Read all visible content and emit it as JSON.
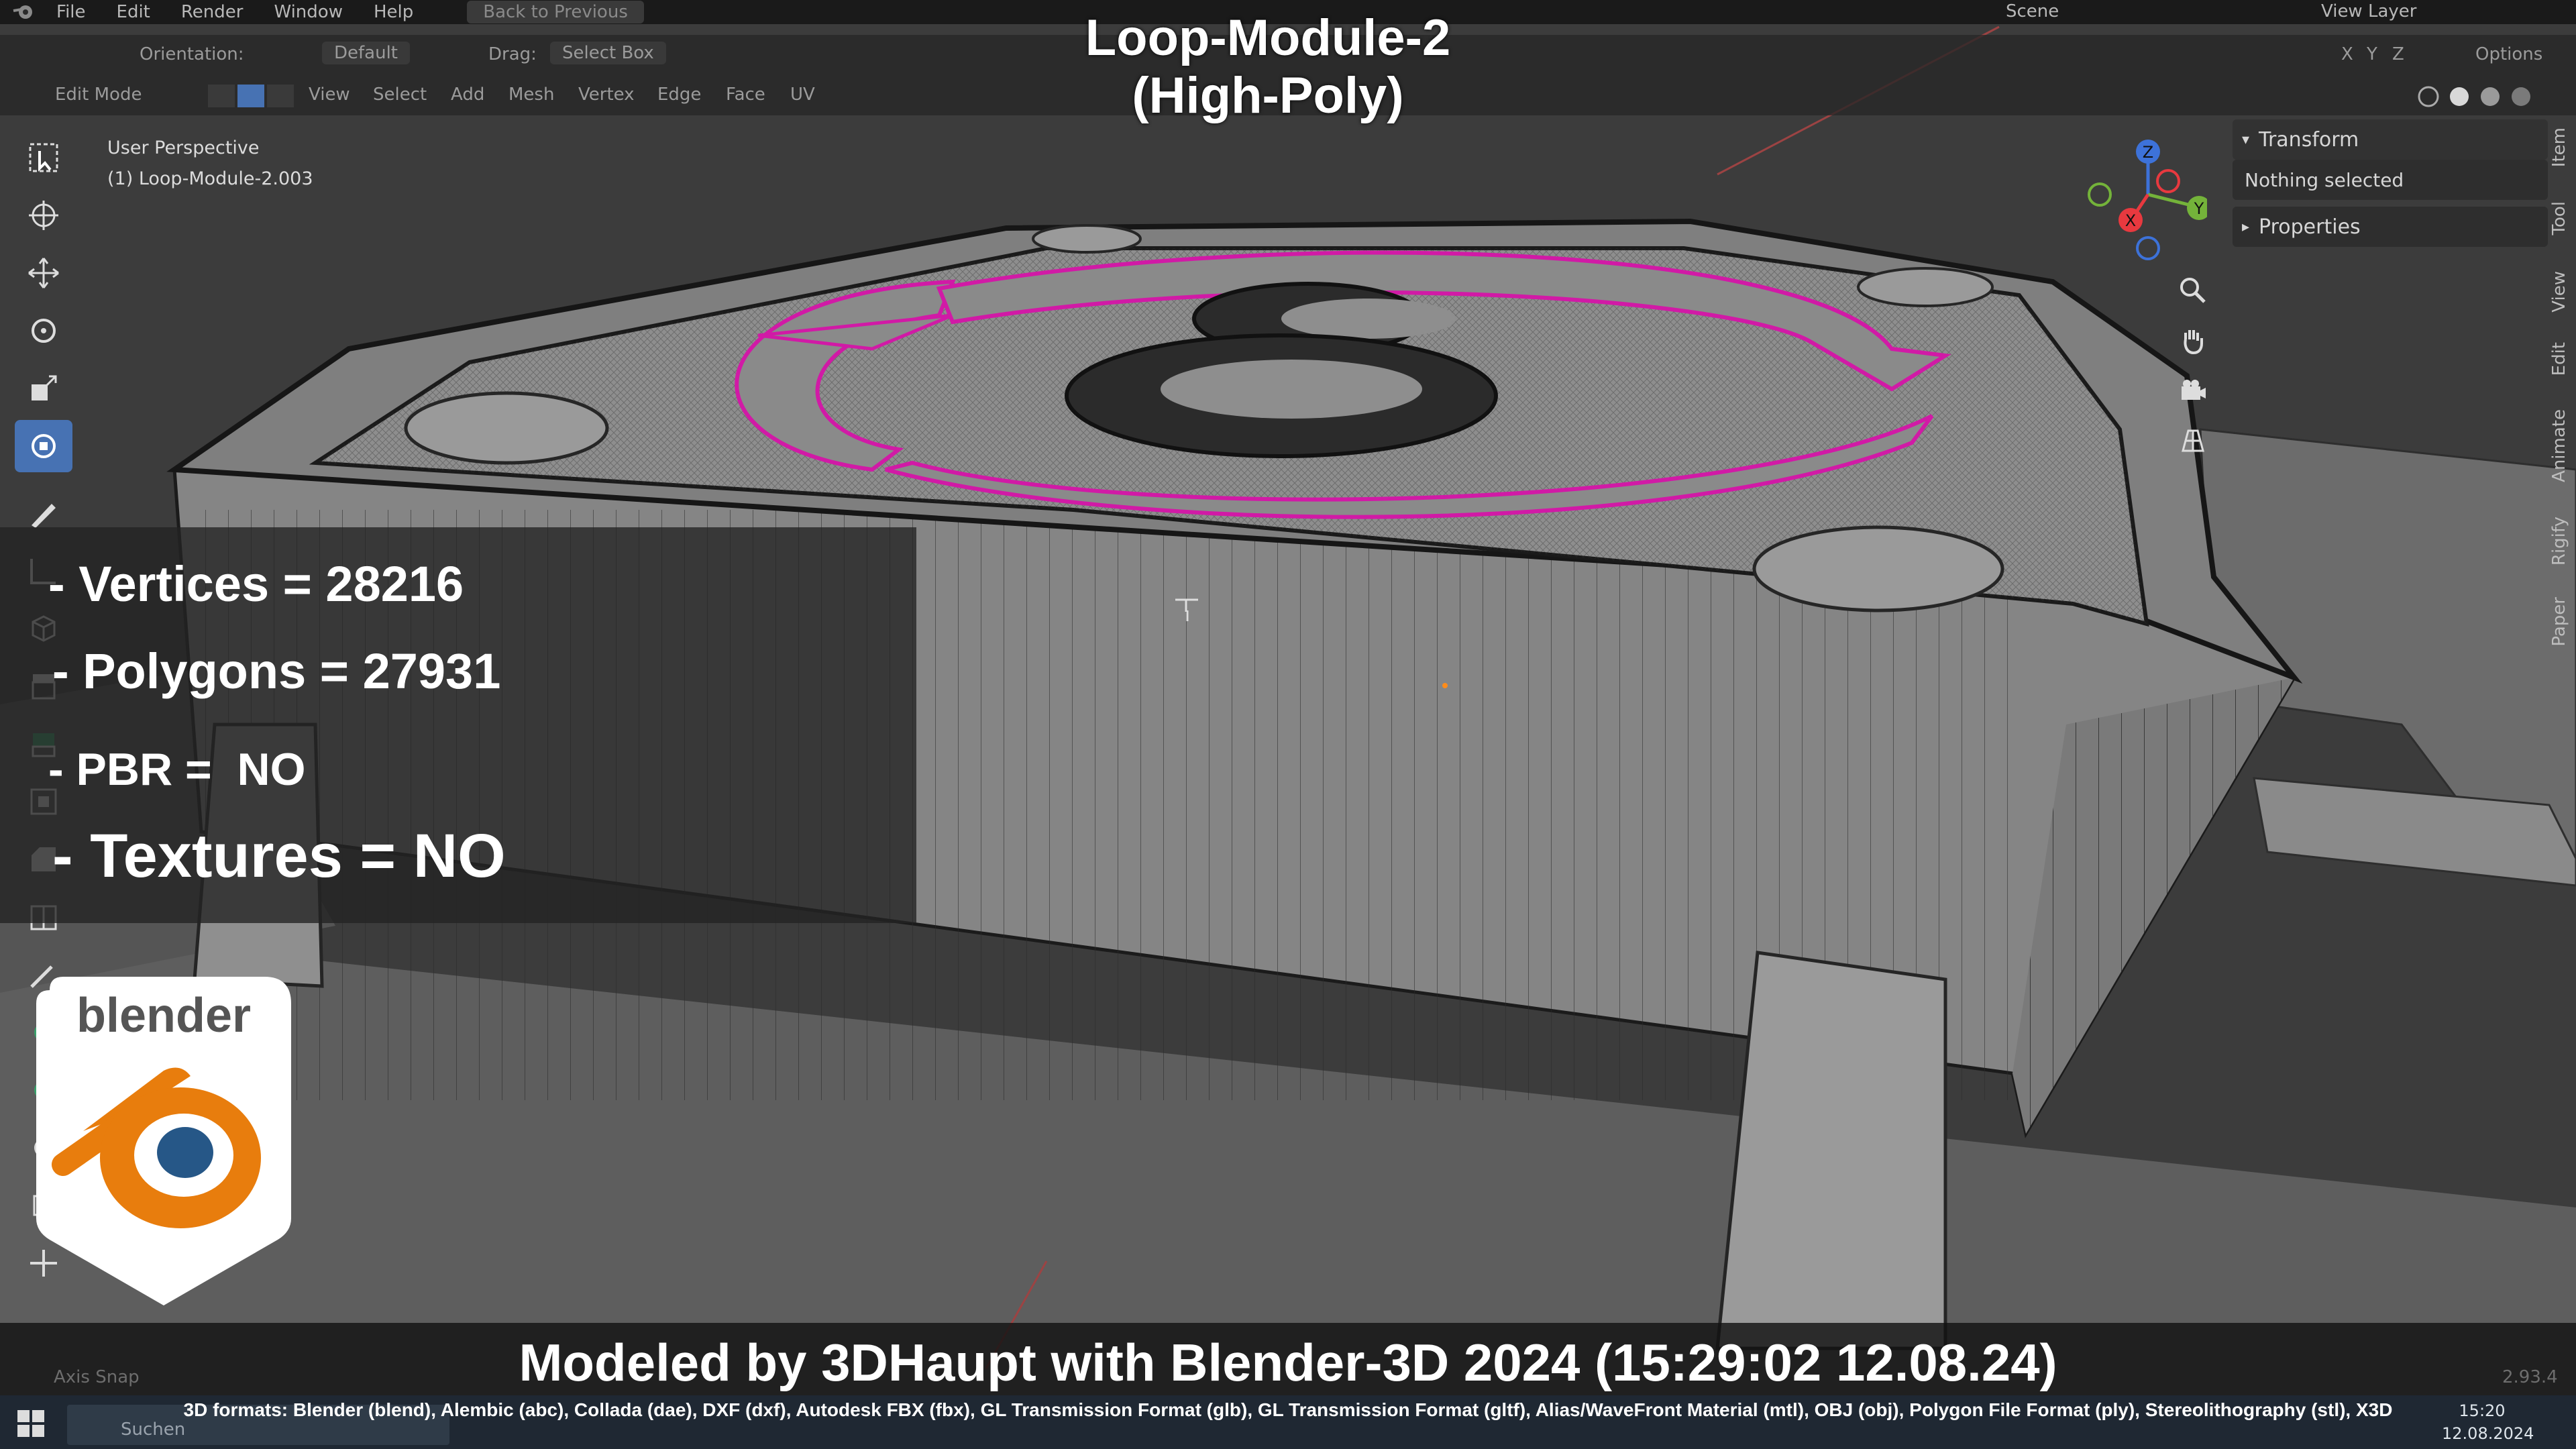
{
  "app": {
    "menu": [
      "File",
      "Edit",
      "Render",
      "Window",
      "Help"
    ],
    "back_button": "Back to Previous",
    "scene_label": "Scene",
    "view_layer_label": "View Layer"
  },
  "header": {
    "orientation_label": "Orientation:",
    "orientation_value": "Default",
    "drag_label": "Drag:",
    "drag_value": "Select Box",
    "options_label": "Options",
    "axes": [
      "X",
      "Y",
      "Z"
    ],
    "mode": "Edit Mode",
    "menus": [
      "View",
      "Select",
      "Add",
      "Mesh",
      "Vertex",
      "Edge",
      "Face",
      "UV"
    ]
  },
  "viewport": {
    "perspective": "User Perspective",
    "object": "(1) Loop-Module-2.003"
  },
  "overlay": {
    "title_line1": "Loop-Module-2",
    "title_line2": "(High-Poly)",
    "stats": {
      "vertices": "- Vertices = 28216",
      "polygons": "- Polygons = 27931",
      "pbr": "- PBR =  NO",
      "textures": "- Textures = NO"
    },
    "logo_text": "blender",
    "footer_title": "Modeled by 3DHaupt with Blender-3D 2024 (15:29:02  12.08.24)",
    "formats": "3D formats: Blender (blend), Alembic (abc), Collada (dae), DXF (dxf), Autodesk FBX (fbx), GL Transmission Format (glb), GL Transmission Format (gltf), Alias/WaveFront Material (mtl), OBJ (obj), Polygon File Format (ply), Stereolithography (stl), X3D"
  },
  "sidebar": {
    "transform": "Transform",
    "nothing_selected": "Nothing selected",
    "properties": "Properties",
    "tabs": [
      "Item",
      "Tool",
      "View",
      "Edit",
      "Animate",
      "Rigify",
      "Paper"
    ]
  },
  "gizmo": {
    "z": "Z",
    "y": "Y",
    "x": "X"
  },
  "status": {
    "axis_snap": "Axis Snap",
    "version": "2.93.4"
  },
  "taskbar": {
    "search_placeholder": "Suchen",
    "time": "15:20",
    "date": "12.08.2024"
  },
  "colors": {
    "accent": "#4772b3",
    "edge_highlight": "#d11aa6",
    "blender_orange": "#e87d0d",
    "blender_blue": "#265787"
  }
}
